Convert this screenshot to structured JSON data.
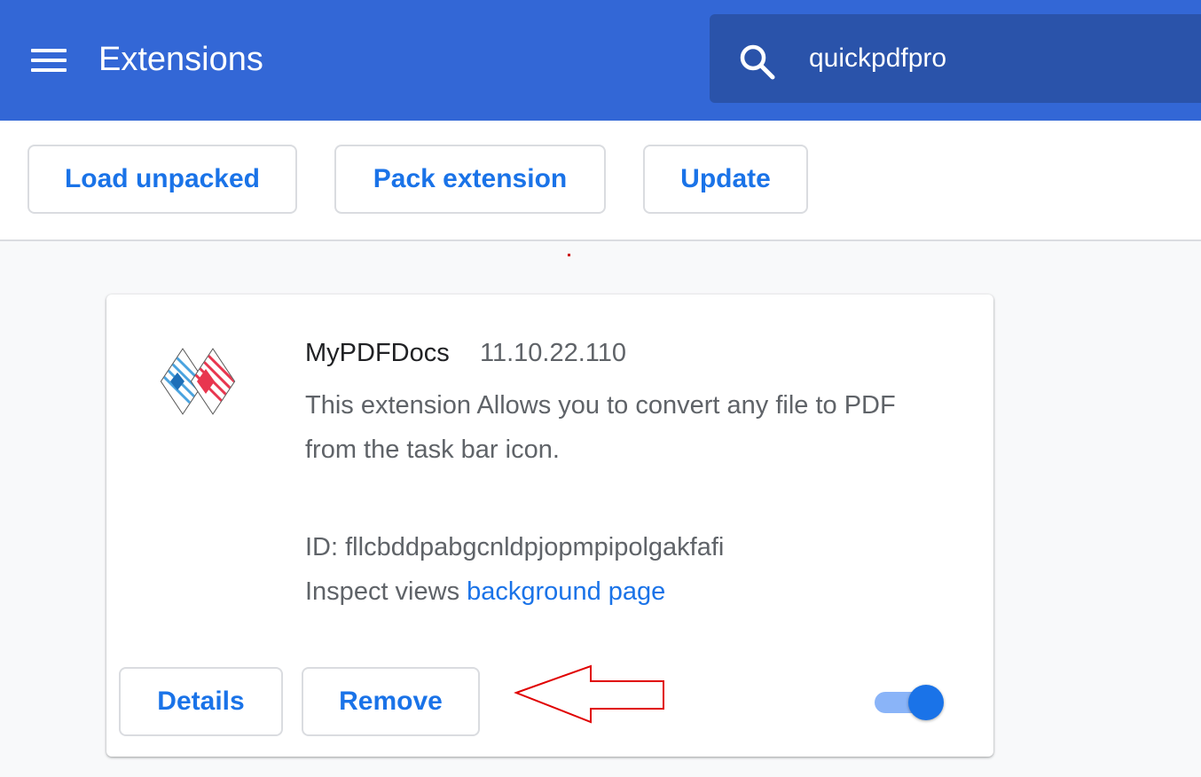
{
  "header": {
    "title": "Extensions",
    "search_value": "quickpdfpro",
    "background_color": "#3367d6"
  },
  "toolbar": {
    "load_unpacked_label": "Load unpacked",
    "pack_extension_label": "Pack extension",
    "update_label": "Update"
  },
  "extension": {
    "name": "MyPDFDocs",
    "version": "11.10.22.110",
    "description": "This extension Allows you to convert any file to PDF from the task bar icon.",
    "id_label": "ID:",
    "id_value": "fllcbddpabgcnldpjopmpipolgakfafi",
    "inspect_label": "Inspect views",
    "inspect_link": "background page",
    "details_label": "Details",
    "remove_label": "Remove",
    "enabled": true
  },
  "icons": {
    "menu": "hamburger-menu-icon",
    "search": "search-icon",
    "extension_logo": "mypdfdocs-logo",
    "annotation": "red-arrow-annotation"
  },
  "colors": {
    "accent": "#1a73e8",
    "annotation": "#e00000"
  }
}
